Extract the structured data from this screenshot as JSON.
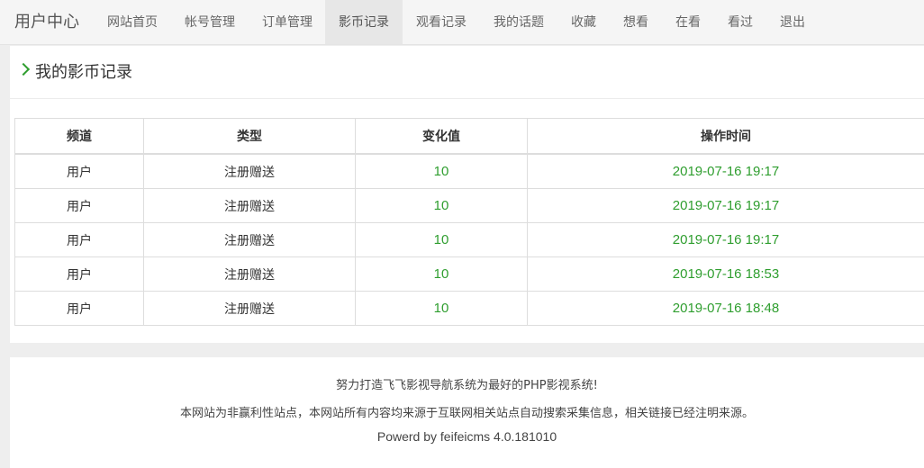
{
  "nav": {
    "brand": "用户中心",
    "items": [
      {
        "label": "网站首页",
        "active": false
      },
      {
        "label": "帐号管理",
        "active": false
      },
      {
        "label": "订单管理",
        "active": false
      },
      {
        "label": "影币记录",
        "active": true
      },
      {
        "label": "观看记录",
        "active": false
      },
      {
        "label": "我的话题",
        "active": false
      },
      {
        "label": "收藏",
        "active": false
      },
      {
        "label": "想看",
        "active": false
      },
      {
        "label": "在看",
        "active": false
      },
      {
        "label": "看过",
        "active": false
      },
      {
        "label": "退出",
        "active": false
      }
    ]
  },
  "section": {
    "icon": "chevron-right-icon",
    "title": "我的影币记录"
  },
  "table": {
    "headers": [
      "频道",
      "类型",
      "变化值",
      "操作时间"
    ],
    "rows": [
      [
        "用户",
        "注册赠送",
        "10",
        "2019-07-16 19:17"
      ],
      [
        "用户",
        "注册赠送",
        "10",
        "2019-07-16 19:17"
      ],
      [
        "用户",
        "注册赠送",
        "10",
        "2019-07-16 19:17"
      ],
      [
        "用户",
        "注册赠送",
        "10",
        "2019-07-16 18:53"
      ],
      [
        "用户",
        "注册赠送",
        "10",
        "2019-07-16 18:48"
      ]
    ]
  },
  "footer": {
    "line1": "努力打造飞飞影视导航系统为最好的PHP影视系统!",
    "line2": "本网站为非赢利性站点，本网站所有内容均来源于互联网相关站点自动搜索采集信息，相关链接已经注明来源。",
    "line3": "Powerd by feifeicms 4.0.181010"
  },
  "colors": {
    "accent_green": "#2f9e2f",
    "active_tab_bg": "#e7e7e7",
    "page_bg": "#eeeeee"
  }
}
